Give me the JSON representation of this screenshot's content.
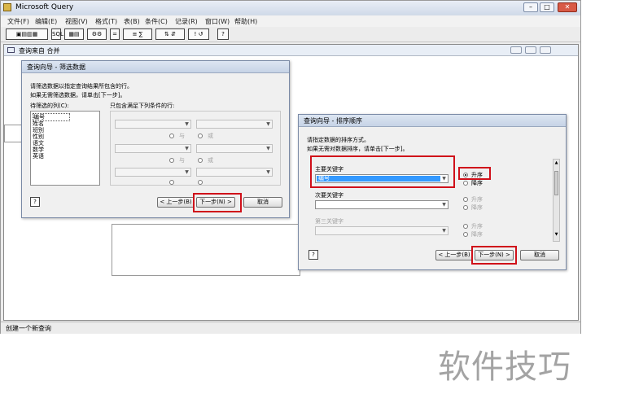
{
  "app": {
    "title": "Microsoft Query",
    "menu": [
      "文件(F)",
      "编辑(E)",
      "视图(V)",
      "格式(T)",
      "表(B)",
      "条件(C)",
      "记录(R)",
      "窗口(W)",
      "帮助(H)"
    ],
    "toolbar": [
      "SQL",
      "∑",
      "⊞",
      "⊟",
      "!",
      "?"
    ],
    "status": "创建一个新查询"
  },
  "query_window": {
    "title": "查询来自 合并"
  },
  "filter_dialog": {
    "title": "查询向导 - 筛选数据",
    "instruction_1": "请筛选数据以指定查询结果所包含的行。",
    "instruction_2": "如果无需筛选数据，请单击[下一步]。",
    "columns_label": "待筛选的列(C):",
    "conditions_label": "只包含满足下列条件的行:",
    "columns": [
      "编号",
      "姓名",
      "班别",
      "性别",
      "语文",
      "数学",
      "英语"
    ],
    "and_label": "与",
    "or_label": "或",
    "back_button": "< 上一步(B)",
    "next_button": "下一步(N) >",
    "cancel_button": "取消"
  },
  "sort_dialog": {
    "title": "查询向导 - 排序顺序",
    "instruction_1": "请指定数据的排序方式。",
    "instruction_2": "如果无需对数据排序，请单击[下一步]。",
    "primary_key_label": "主要关键字",
    "primary_key_value": "编号",
    "secondary_key_label": "次要关键字",
    "third_key_label": "第三关键字",
    "ascending": "升序",
    "descending": "降序",
    "back_button": "< 上一步(B)",
    "next_button": "下一步(N) >",
    "cancel_button": "取消"
  },
  "watermark": "软件技巧",
  "colors": {
    "highlight": "#d0101a",
    "selection": "#3399ff"
  }
}
